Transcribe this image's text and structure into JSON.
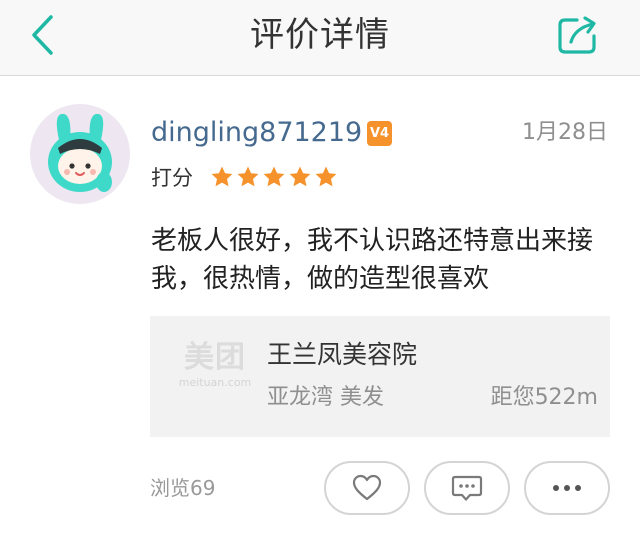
{
  "header": {
    "title": "评价详情",
    "back_icon": "chevron-left-icon",
    "share_icon": "share-icon",
    "accent_color": "#1fb8a4"
  },
  "review": {
    "username": "dingling871219",
    "vip_badge": "V4",
    "date": "1月28日",
    "rating_label": "打分",
    "rating": 5,
    "rating_max": 5,
    "star_color": "#f5922b",
    "text": "老板人很好，我不认识路还特意出来接我，很热情，做的造型很喜欢"
  },
  "shop": {
    "logo_text": "美团",
    "logo_subtext": "meituan.com",
    "name": "王兰凤美容院",
    "area": "亚龙湾 美发",
    "distance": "距您522m"
  },
  "footer": {
    "views": "浏览69",
    "like_icon": "heart-icon",
    "comment_icon": "comment-icon",
    "more_icon": "more-icon"
  }
}
